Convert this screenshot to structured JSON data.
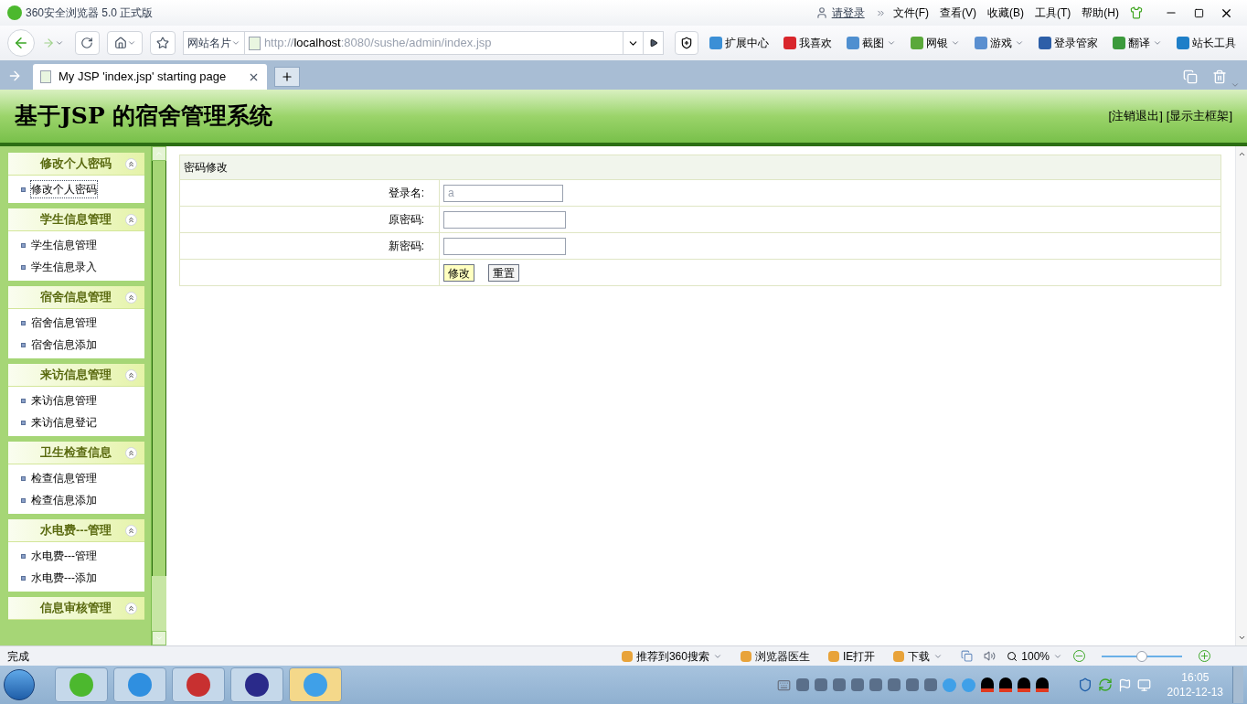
{
  "window": {
    "title": "360安全浏览器 5.0 正式版",
    "login": "请登录",
    "menu": [
      "文件(F)",
      "查看(V)",
      "收藏(B)",
      "工具(T)",
      "帮助(H)"
    ]
  },
  "toolbar": {
    "site_card": "网站名片",
    "url_scheme": "http://",
    "url_host": "localhost",
    "url_rest": ":8080/sushe/admin/index.jsp",
    "tools": [
      {
        "label": "扩展中心",
        "dropdown": false,
        "color": "#3b8fd6"
      },
      {
        "label": "我喜欢",
        "dropdown": false,
        "color": "#d9262c"
      },
      {
        "label": "截图",
        "dropdown": true,
        "color": "#4f8fd0"
      },
      {
        "label": "网银",
        "dropdown": true,
        "color": "#5aa83a"
      },
      {
        "label": "游戏",
        "dropdown": true,
        "color": "#5a8fd0"
      },
      {
        "label": "登录管家",
        "dropdown": false,
        "color": "#2d5fa8"
      },
      {
        "label": "翻译",
        "dropdown": true,
        "color": "#3c9a3c"
      },
      {
        "label": "站长工具",
        "dropdown": false,
        "color": "#1f7fc8"
      }
    ]
  },
  "tabs": [
    {
      "label": "My JSP 'index.jsp' starting page",
      "selected": true
    }
  ],
  "header": {
    "title": "基于JSP 的宿舍管理系统",
    "links": [
      "[注销退出]",
      "[显示主框架]"
    ]
  },
  "sidebar": [
    {
      "title": "修改个人密码",
      "expanded": true,
      "items": [
        {
          "label": "修改个人密码",
          "focused": true
        }
      ]
    },
    {
      "title": "学生信息管理",
      "expanded": true,
      "items": [
        {
          "label": "学生信息管理",
          "focused": false
        },
        {
          "label": "学生信息录入",
          "focused": false
        }
      ]
    },
    {
      "title": "宿舍信息管理",
      "expanded": true,
      "items": [
        {
          "label": "宿舍信息管理",
          "focused": false
        },
        {
          "label": "宿舍信息添加",
          "focused": false
        }
      ]
    },
    {
      "title": "来访信息管理",
      "expanded": true,
      "items": [
        {
          "label": "来访信息管理",
          "focused": false
        },
        {
          "label": "来访信息登记",
          "focused": false
        }
      ]
    },
    {
      "title": "卫生检查信息",
      "expanded": true,
      "items": [
        {
          "label": "检查信息管理",
          "focused": false
        },
        {
          "label": "检查信息添加",
          "focused": false
        }
      ]
    },
    {
      "title": "水电费---管理",
      "expanded": true,
      "items": [
        {
          "label": "水电费---管理",
          "focused": false
        },
        {
          "label": "水电费---添加",
          "focused": false
        }
      ]
    },
    {
      "title": "信息审核管理",
      "expanded": true
    }
  ],
  "form": {
    "title": "密码修改",
    "fields": [
      {
        "label": "登录名:",
        "value": "a",
        "disabled": true
      },
      {
        "label": "原密码:",
        "disabled": false
      },
      {
        "label": "新密码:",
        "disabled": false
      }
    ],
    "buttons": [
      {
        "label": "修改",
        "highlighted": true
      },
      {
        "label": "重置",
        "highlighted": false
      }
    ]
  },
  "status_bar": {
    "status": "完成",
    "items": [
      {
        "label": "推荐到360搜索",
        "dropdown": true
      },
      {
        "label": "浏览器医生",
        "dropdown": false
      },
      {
        "label": "IE打开",
        "dropdown": false
      },
      {
        "label": "下载",
        "dropdown": true
      }
    ],
    "zoom": "100%",
    "level": 0.5
  },
  "taskbar": {
    "time": "16:05",
    "date": "2012-12-13"
  }
}
